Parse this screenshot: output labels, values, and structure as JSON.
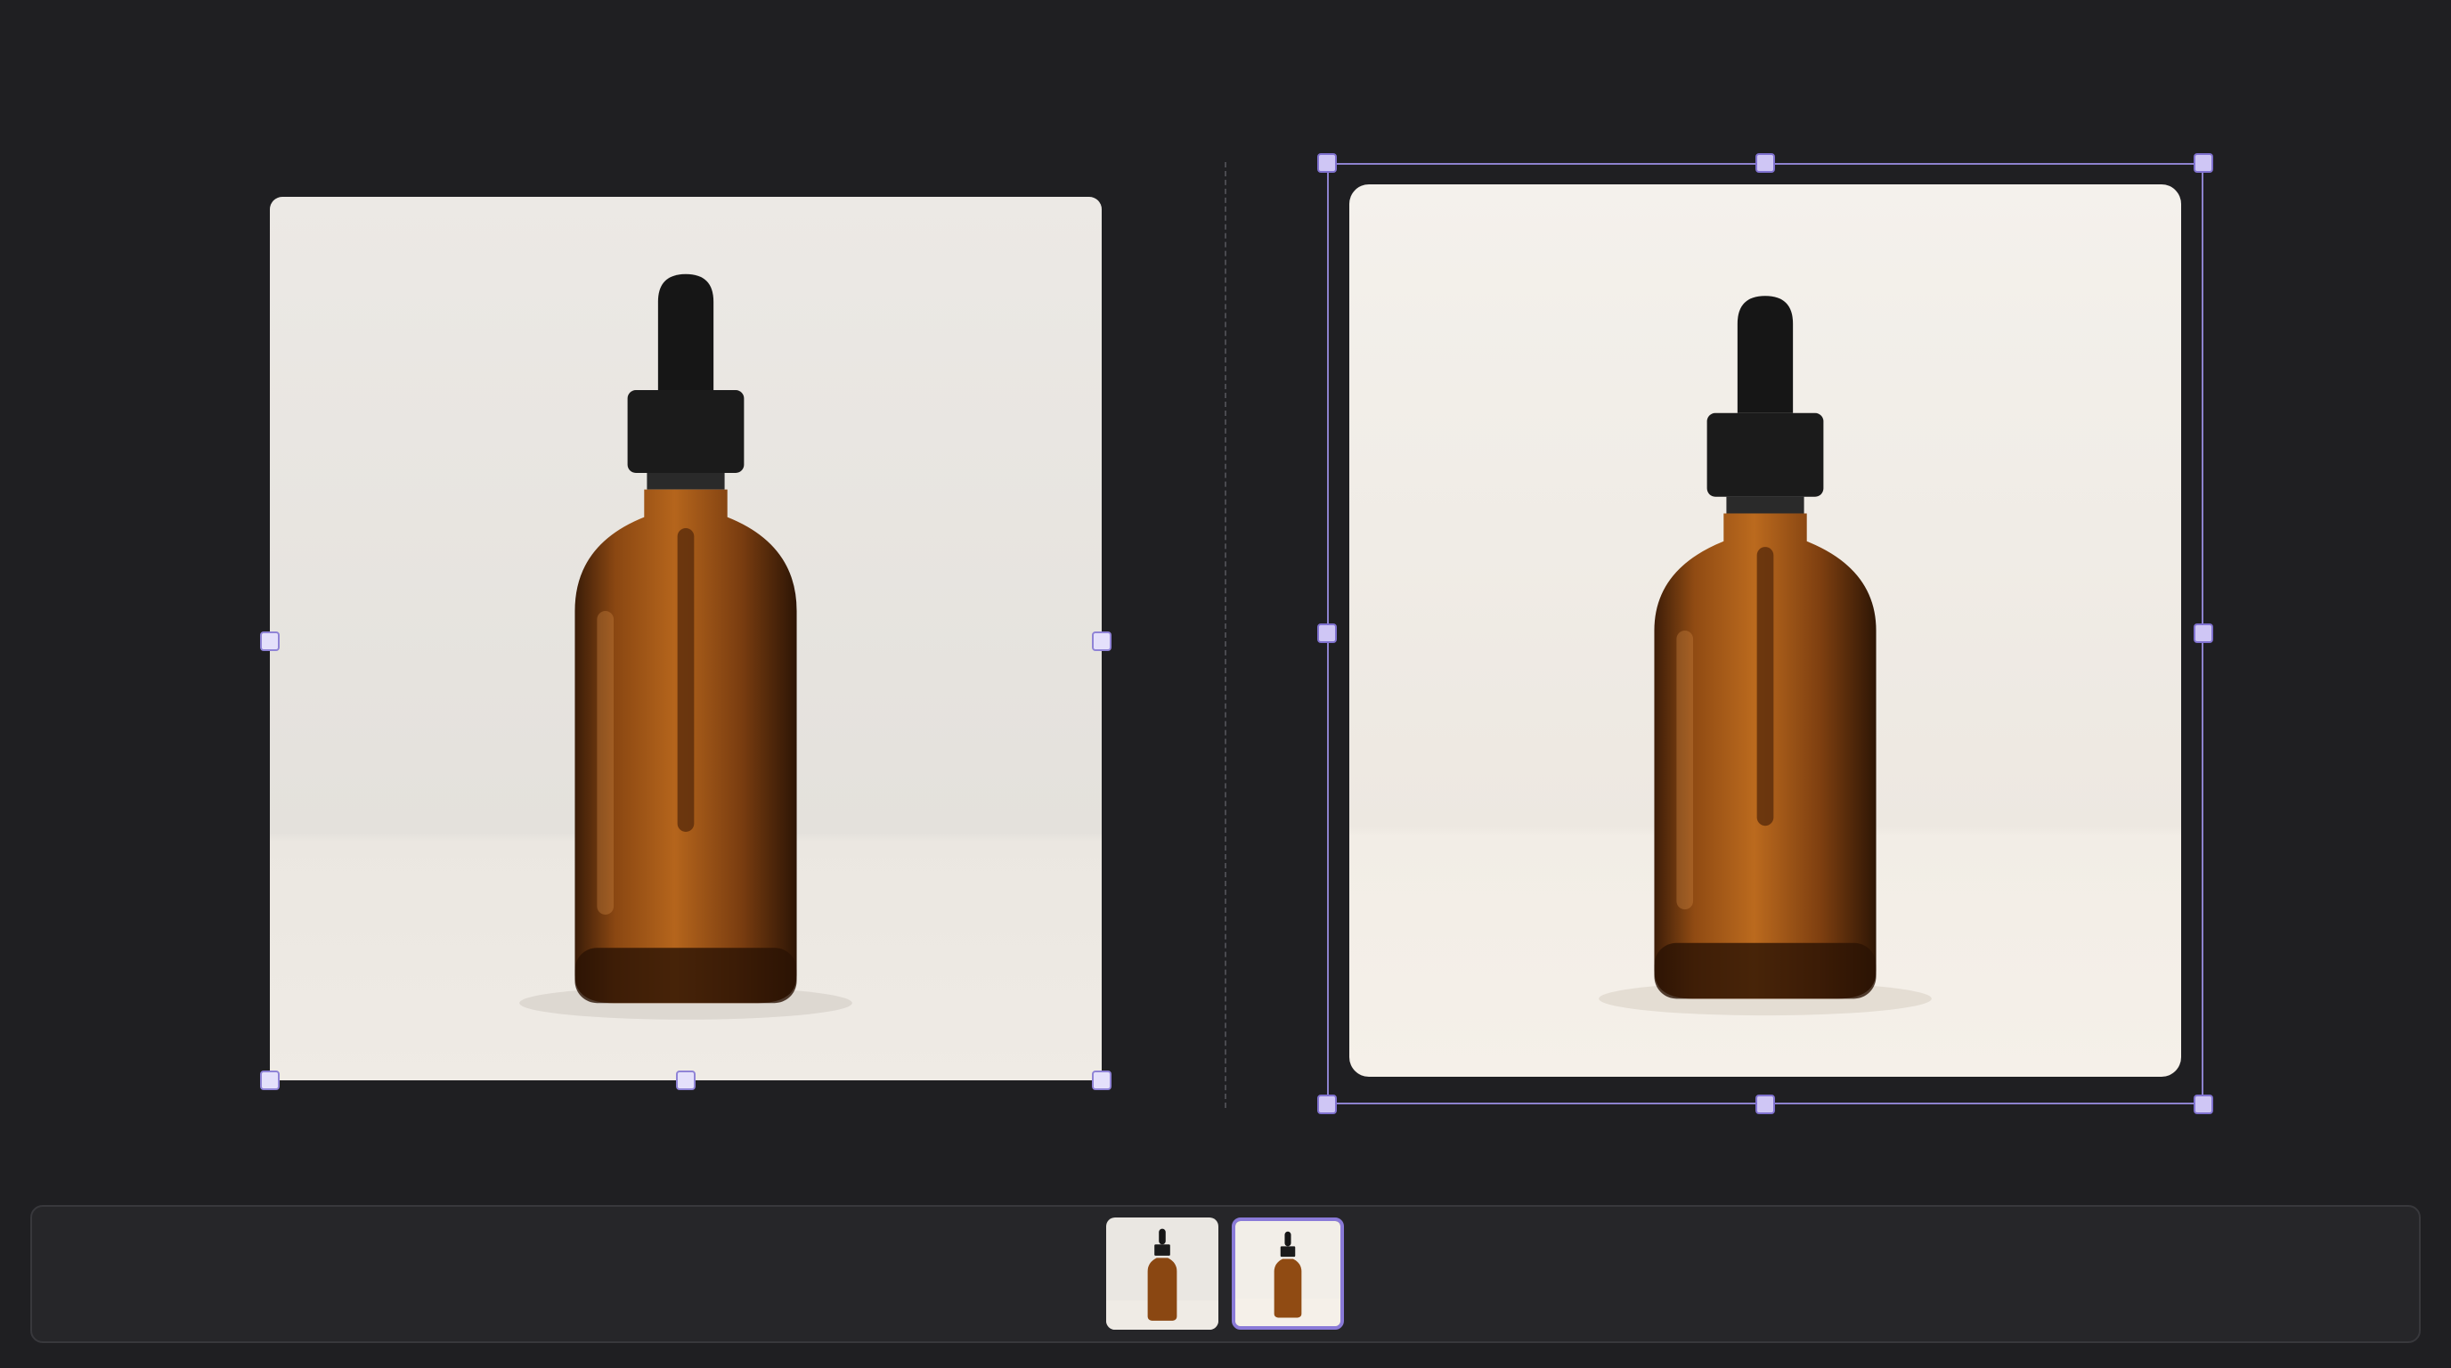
{
  "canvas": {
    "images": [
      {
        "name": "product-photo-original",
        "selected": false,
        "background": "#ebe8e3"
      },
      {
        "name": "product-photo-variant",
        "selected": true,
        "background": "#f2eee8"
      }
    ]
  },
  "filmstrip": {
    "thumbnails": [
      {
        "name": "thumbnail-1",
        "selected": false
      },
      {
        "name": "thumbnail-2",
        "selected": true
      }
    ]
  },
  "colors": {
    "app_background": "#1f1f22",
    "selection_accent": "#8a7ad8",
    "handle_fill": "#e4e0fb",
    "filmstrip_background": "#262629"
  },
  "icons": [
    "dropper-bottle-image"
  ]
}
